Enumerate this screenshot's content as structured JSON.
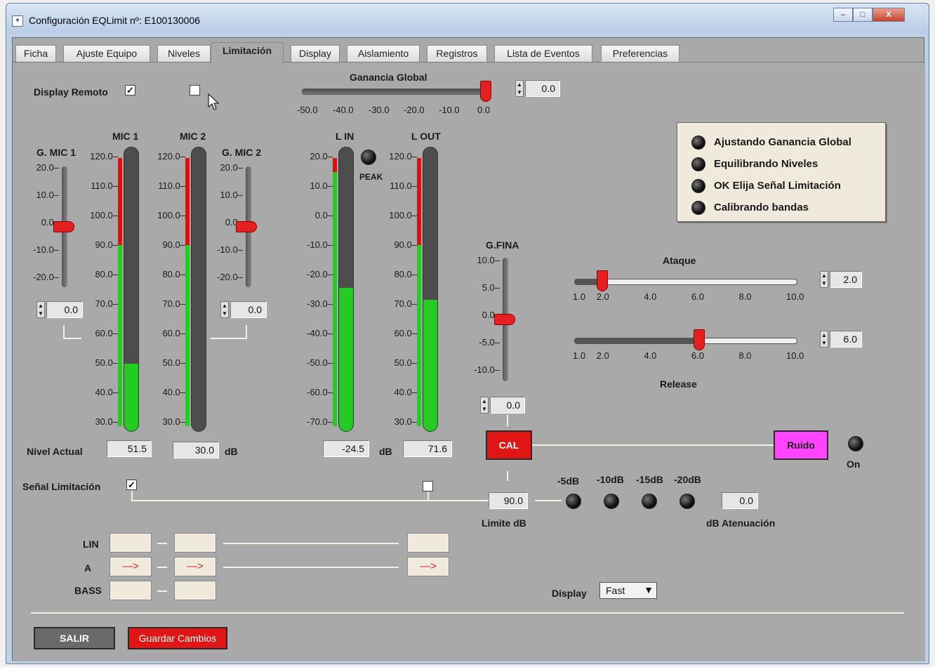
{
  "window": {
    "title": "Configuración EQLimit nº: E100130006",
    "min_label": "–",
    "max_label": "□",
    "close_label": "X"
  },
  "tabs": [
    "Ficha",
    "Ajuste Equipo",
    "Niveles",
    "Limitación",
    "Display",
    "Aislamiento",
    "Registros",
    "Lista de Eventos",
    "Preferencias"
  ],
  "active_tab": "Limitación",
  "display_remoto": {
    "label": "Display Remoto",
    "checked": true
  },
  "ganancia_global": {
    "label": "Ganancia Global",
    "value": "0.0",
    "ticks": [
      "-50.0",
      "-40.0",
      "-30.0",
      "-20.0",
      "-10.0",
      "0.0"
    ]
  },
  "legend": {
    "items": [
      "Ajustando Ganancia Global",
      "Equilibrando Niveles",
      "OK Elija Señal Limitación",
      "Calibrando bandas"
    ]
  },
  "gmic1": {
    "label": "G. MIC 1",
    "ticks": [
      "20.0",
      "10.0",
      "0.0",
      "-10.0",
      "-20.0"
    ],
    "value": "0.0"
  },
  "gmic2": {
    "label": "G. MIC 2",
    "ticks": [
      "20.0",
      "10.0",
      "0.0",
      "-10.0",
      "-20.0"
    ],
    "value": "0.0"
  },
  "mic1": {
    "label": "MIC 1",
    "ticks": [
      "120.0",
      "110.0",
      "100.0",
      "90.0",
      "80.0",
      "70.0",
      "60.0",
      "50.0",
      "40.0",
      "30.0"
    ],
    "value": "51.5",
    "level": 0.2375
  },
  "mic2": {
    "label": "MIC 2",
    "ticks": [
      "120.0",
      "110.0",
      "100.0",
      "90.0",
      "80.0",
      "70.0",
      "60.0",
      "50.0",
      "40.0",
      "30.0"
    ],
    "value": "30.0",
    "level": 0.0
  },
  "lin_meter": {
    "label": "L IN",
    "ticks": [
      "20.0",
      "10.0",
      "0.0",
      "-10.0",
      "-20.0",
      "-30.0",
      "-40.0",
      "-50.0",
      "-60.0",
      "-70.0"
    ],
    "value": "-24.5",
    "level": 0.505
  },
  "lout_meter": {
    "label": "L OUT",
    "ticks": [
      "120.0",
      "110.0",
      "100.0",
      "90.0",
      "80.0",
      "70.0",
      "60.0",
      "50.0",
      "40.0",
      "30.0"
    ],
    "value": "71.6",
    "level": 0.462
  },
  "peak_label": "PEAK",
  "nivel_actual_label": "Nivel Actual",
  "db_label": "dB",
  "gfina": {
    "label": "G.FINA",
    "ticks": [
      "10.0",
      "5.0",
      "0.0",
      "-5.0",
      "-10.0"
    ],
    "value": "0.0"
  },
  "ataque": {
    "label": "Ataque",
    "value": "2.0",
    "ticks": [
      "1.0",
      "2.0",
      "4.0",
      "6.0",
      "8.0",
      "10.0"
    ]
  },
  "release": {
    "label": "Release",
    "value": "6.0",
    "ticks": [
      "1.0",
      "2.0",
      "4.0",
      "6.0",
      "8.0",
      "10.0"
    ]
  },
  "cal_button": "CAL",
  "ruido_button": "Ruido",
  "on_label": "On",
  "senal_limitacion": {
    "label": "Señal Limitación",
    "checked": true
  },
  "limite": {
    "value": "90.0",
    "label": "Limite  dB"
  },
  "atten_steps": [
    "-5dB",
    "-10dB",
    "-15dB",
    "-20dB"
  ],
  "atenuacion": {
    "value": "0.0",
    "label": "dB Atenuación"
  },
  "routing": {
    "rows": [
      "LIN",
      "A",
      "BASS"
    ],
    "arrow": "—>"
  },
  "display_mode": {
    "label": "Display",
    "value": "Fast"
  },
  "salir_button": "SALIR",
  "guardar_button": "Guardar Cambios",
  "colors": {
    "panel": "#a9a9a9",
    "meter_green": "#22cc22",
    "meter_red": "#dd1111",
    "slider_red": "#e42020",
    "cal_red": "#e01515",
    "ruido_magenta": "#ff44ff",
    "legend_bg": "#efeadb"
  }
}
